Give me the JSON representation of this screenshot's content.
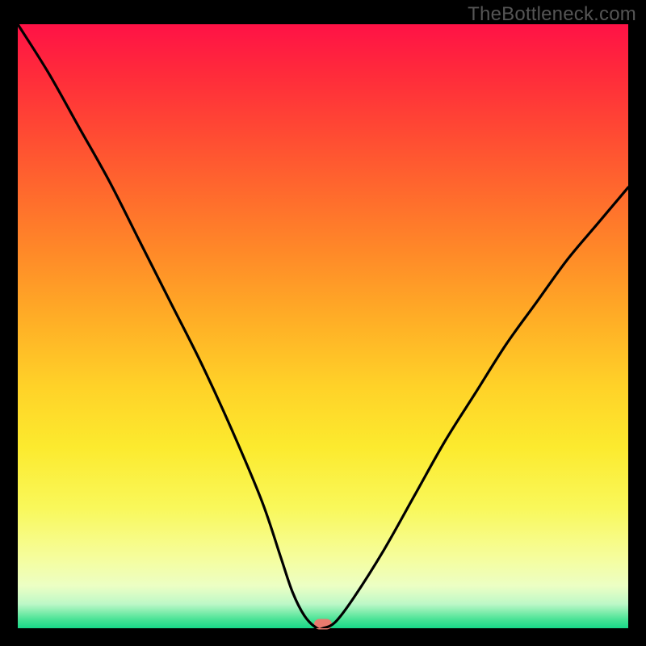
{
  "watermark": "TheBottleneck.com",
  "chart_data": {
    "type": "line",
    "title": "",
    "xlabel": "",
    "ylabel": "",
    "xlim": [
      0,
      100
    ],
    "ylim": [
      0,
      100
    ],
    "grid": false,
    "legend": false,
    "background": "rainbow-gradient-red-to-green",
    "series": [
      {
        "name": "bottleneck-curve",
        "x": [
          0,
          5,
          10,
          15,
          20,
          25,
          30,
          35,
          40,
          43,
          45,
          47,
          49,
          50,
          52,
          55,
          60,
          65,
          70,
          75,
          80,
          85,
          90,
          95,
          100
        ],
        "values": [
          100,
          92,
          83,
          74,
          64,
          54,
          44,
          33,
          21,
          12,
          6,
          2,
          0,
          0,
          1,
          5,
          13,
          22,
          31,
          39,
          47,
          54,
          61,
          67,
          73
        ]
      }
    ],
    "marker": {
      "x": 50,
      "y": 0,
      "color": "#e97a6e"
    },
    "gradient_stops": [
      {
        "pos": 0,
        "color": "#ff1246"
      },
      {
        "pos": 0.5,
        "color": "#ffd228"
      },
      {
        "pos": 0.9,
        "color": "#f6fd9a"
      },
      {
        "pos": 1.0,
        "color": "#18d888"
      }
    ]
  }
}
